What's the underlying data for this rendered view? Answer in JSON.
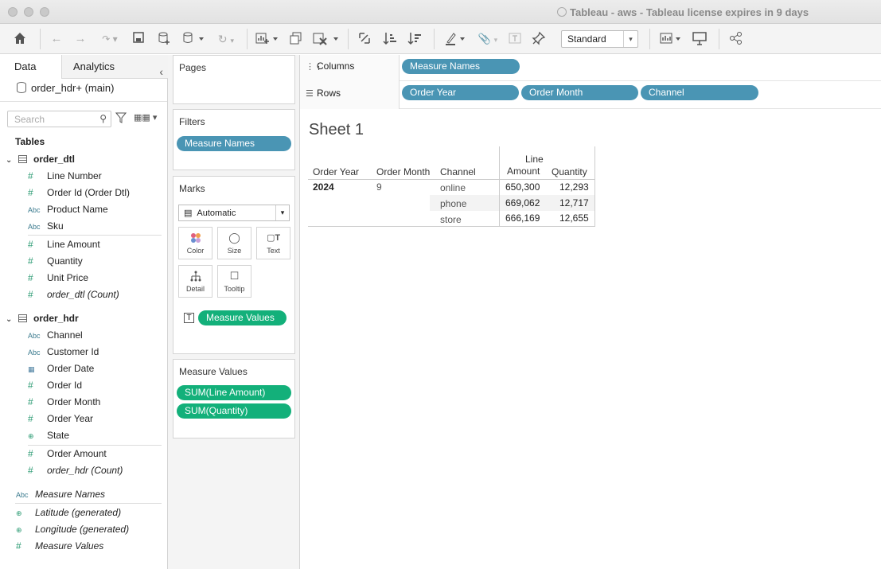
{
  "window": {
    "title": "Tableau - aws - Tableau license expires in 9 days"
  },
  "toolbar": {
    "view_mode": "Standard"
  },
  "left_pane": {
    "tabs": [
      "Data",
      "Analytics"
    ],
    "datasource": "order_hdr+ (main)",
    "search_placeholder": "Search",
    "tables_heading": "Tables",
    "groups": [
      {
        "name": "order_dtl",
        "fields": [
          {
            "name": "Line Number",
            "type": "#"
          },
          {
            "name": "Order Id (Order Dtl)",
            "type": "#"
          },
          {
            "name": "Product Name",
            "type": "Abc"
          },
          {
            "name": "Sku",
            "type": "Abc"
          },
          {
            "name": "Line Amount",
            "type": "#"
          },
          {
            "name": "Quantity",
            "type": "#"
          },
          {
            "name": "Unit Price",
            "type": "#"
          },
          {
            "name": "order_dtl (Count)",
            "type": "#"
          }
        ]
      },
      {
        "name": "order_hdr",
        "fields": [
          {
            "name": "Channel",
            "type": "Abc"
          },
          {
            "name": "Customer Id",
            "type": "Abc"
          },
          {
            "name": "Order Date",
            "type": "date"
          },
          {
            "name": "Order Id",
            "type": "#"
          },
          {
            "name": "Order Month",
            "type": "#"
          },
          {
            "name": "Order Year",
            "type": "#"
          },
          {
            "name": "State",
            "type": "geo"
          },
          {
            "name": "Order Amount",
            "type": "#"
          },
          {
            "name": "order_hdr (Count)",
            "type": "#"
          }
        ]
      }
    ],
    "extra_fields": [
      {
        "name": "Measure Names",
        "type": "Abc"
      },
      {
        "name": "Latitude (generated)",
        "type": "geo"
      },
      {
        "name": "Longitude (generated)",
        "type": "geo"
      },
      {
        "name": "Measure Values",
        "type": "#"
      }
    ]
  },
  "cards": {
    "pages_title": "Pages",
    "filters_title": "Filters",
    "filters_pills": [
      "Measure Names"
    ],
    "marks_title": "Marks",
    "mark_type": "Automatic",
    "mark_buttons": [
      "Color",
      "Size",
      "Text",
      "Detail",
      "Tooltip"
    ],
    "marks_pill": "Measure Values",
    "measure_values_title": "Measure Values",
    "measure_values_pills": [
      "SUM(Line Amount)",
      "SUM(Quantity)"
    ]
  },
  "shelves": {
    "columns_label": "Columns",
    "columns": [
      "Measure Names"
    ],
    "rows_label": "Rows",
    "rows": [
      "Order Year",
      "Order Month",
      "Channel"
    ]
  },
  "sheet": {
    "title": "Sheet 1",
    "headers": {
      "order_year": "Order Year",
      "order_month": "Order Month",
      "channel": "Channel",
      "line_amount_1": "Line",
      "line_amount_2": "Amount",
      "quantity": "Quantity"
    },
    "year": "2024",
    "month": "9",
    "rows": [
      {
        "channel": "online",
        "line_amount": "650,300",
        "quantity": "12,293"
      },
      {
        "channel": "phone",
        "line_amount": "669,062",
        "quantity": "12,717"
      },
      {
        "channel": "store",
        "line_amount": "666,169",
        "quantity": "12,655"
      }
    ]
  }
}
